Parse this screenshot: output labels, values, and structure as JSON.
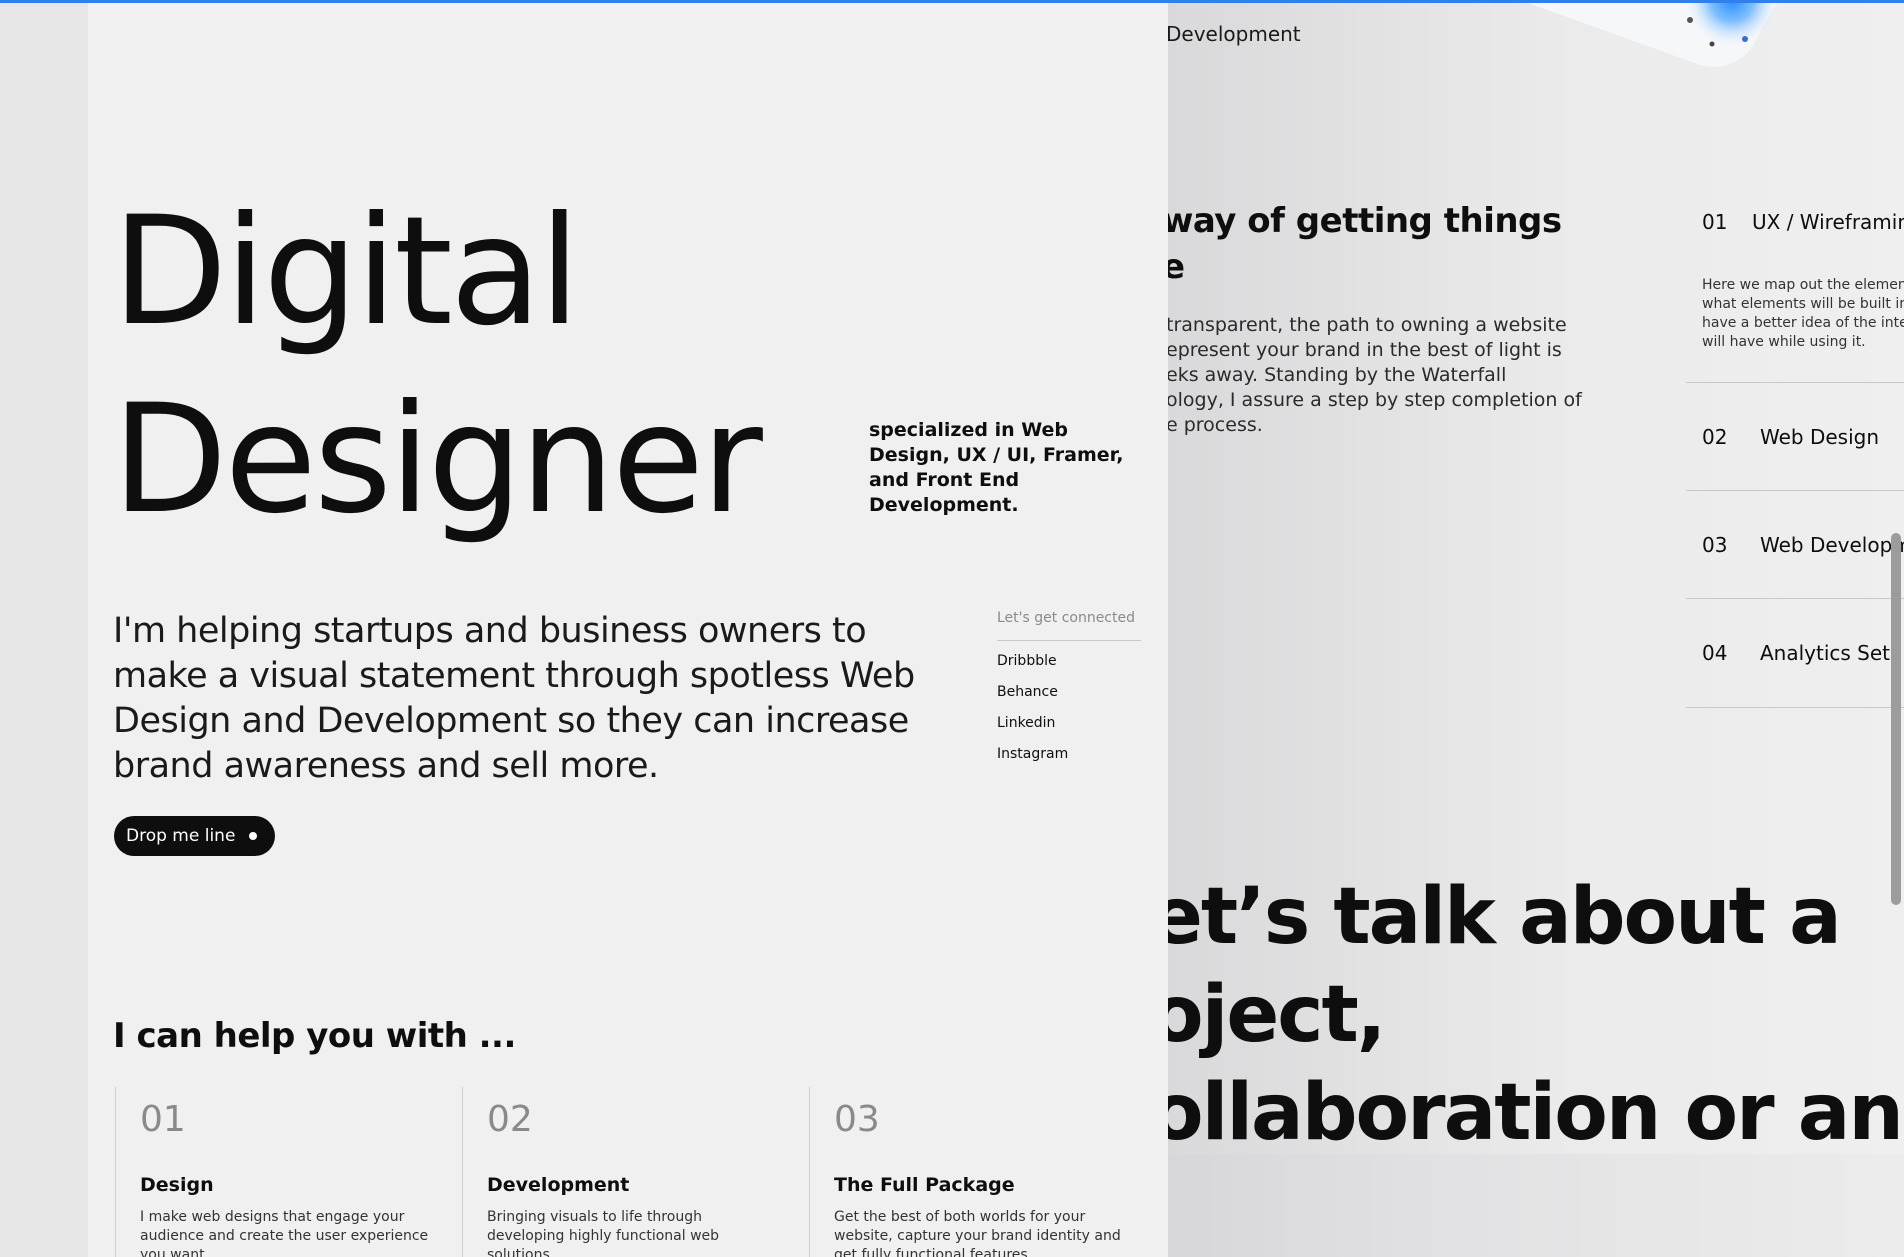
{
  "hero": {
    "line1": "Digital",
    "line2": "Designer",
    "specialized": "specialized in Web Design, UX / UI, Framer, and Front End Development."
  },
  "intro": {
    "text": "I'm helping startups and business owners to make a visual statement through spotless Web Design and Development so they can increase brand awareness and sell more."
  },
  "cta": {
    "label": "Drop me line"
  },
  "connect": {
    "title": "Let's get connected",
    "links": [
      "Dribbble",
      "Behance",
      "Linkedin",
      "Instagram"
    ]
  },
  "help": {
    "title": "I can help you with ...",
    "items": [
      {
        "num": "01",
        "title": "Design",
        "desc": "I make web designs that engage your audience and create the user experience you want"
      },
      {
        "num": "02",
        "title": "Development",
        "desc": "Bringing visuals to life through developing highly functional web solutions."
      },
      {
        "num": "03",
        "title": "The Full Package",
        "desc": "Get the best of both worlds for your website, capture your brand identity and get fully functional features"
      }
    ]
  },
  "peek": {
    "development": "Development",
    "way_line1": "way of getting things",
    "way_line2": "e",
    "para": [
      "transparent, the path to owning a website",
      "epresent your brand in the best of light is",
      "eks away. Standing by the Waterfall",
      "ology, I assure a step by step completion of",
      "e process."
    ],
    "services": [
      {
        "num": "01",
        "title": "UX / Wireframin"
      },
      {
        "num": "02",
        "title": "Web Design"
      },
      {
        "num": "03",
        "title": "Web Developm"
      },
      {
        "num": "04",
        "title": "Analytics Setup"
      }
    ],
    "service_desc": [
      "Here we map out the elemen",
      "what elements will be built int",
      "have a better idea of the inte",
      "will have while using it."
    ],
    "talk": [
      "et’s talk about a",
      "oject,",
      "ollaboration or an"
    ]
  },
  "colors": {
    "accent_bar": "#2f80ed",
    "text": "#0e0e0e",
    "card_bg": "#f0f0f0"
  }
}
